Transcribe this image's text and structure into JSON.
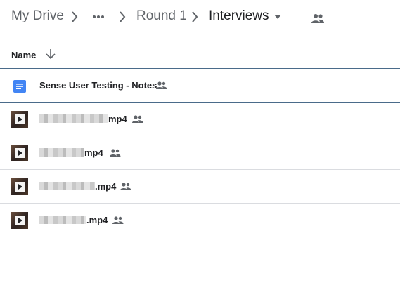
{
  "breadcrumb": {
    "items": [
      "My Drive",
      "Round 1"
    ],
    "more_label": "more-horizontal-icon",
    "current": "Interviews"
  },
  "list": {
    "column_name": "Name",
    "files": [
      {
        "name": "Sense User Testing - Notes",
        "type": "document",
        "shared": true
      },
      {
        "name": "mp4",
        "type": "video",
        "shared": true,
        "redacted": true
      },
      {
        "name": "mp4",
        "type": "video",
        "shared": true,
        "redacted": true
      },
      {
        "name": ".mp4",
        "type": "video",
        "shared": true,
        "redacted": true
      },
      {
        "name": ".mp4",
        "type": "video",
        "shared": true,
        "redacted": true
      }
    ]
  },
  "colors": {
    "doc_blue": "#4285f4",
    "icon_gray": "#5f6368",
    "divider": "#dadce0",
    "selection_border": "#4a6b8a"
  }
}
